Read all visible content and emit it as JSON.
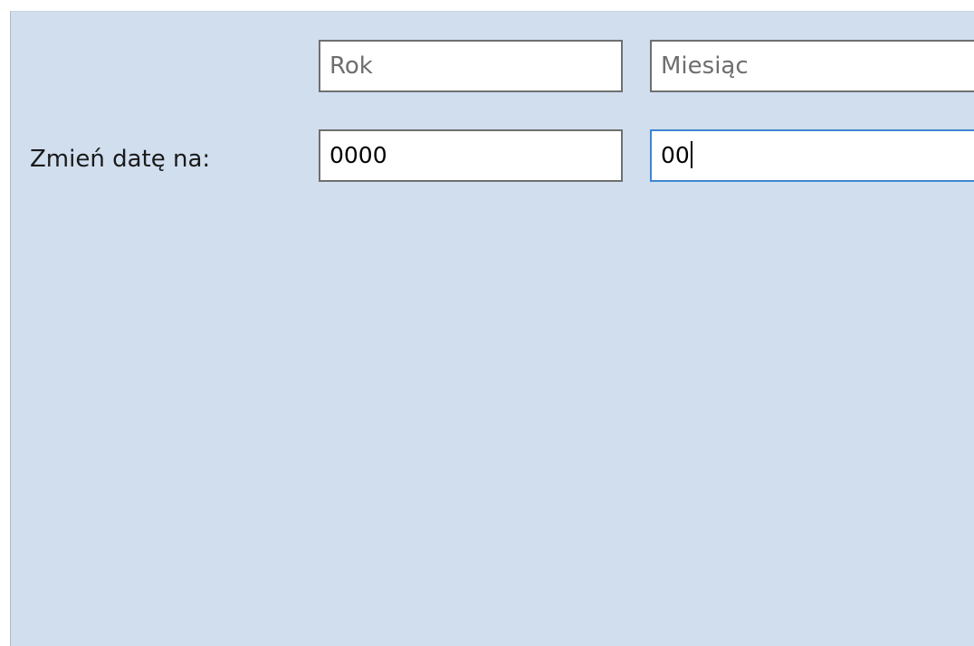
{
  "form": {
    "label": "Zmień datę na:",
    "year_header": "Rok",
    "month_header": "Miesiąc",
    "year_value": "0000",
    "month_value": "00"
  },
  "colors": {
    "panel_background": "#d1deee",
    "focus_border": "#3e86d2"
  }
}
